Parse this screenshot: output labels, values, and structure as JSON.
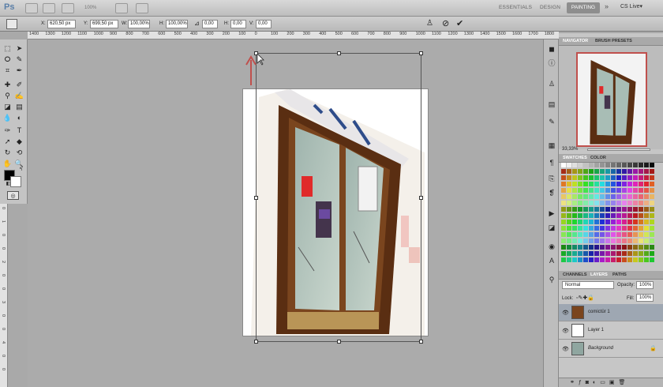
{
  "appbar": {
    "logo": "Ps",
    "zoom": "100%",
    "workspaces": [
      "ESSENTIALS",
      "DESIGN"
    ],
    "active_workspace": "PAINTING",
    "more": "»",
    "cs_live": "CS Live▾"
  },
  "options": {
    "x_label": "X:",
    "x_value": "620,50 px",
    "y_label": "Y:",
    "y_value": "699,50 px",
    "w_label": "W:",
    "w_value": "100,00%",
    "h_label": "H:",
    "h_value": "100,00%",
    "rot_value": "0,00",
    "hskew_label": "H:",
    "hskew_value": "0,00",
    "vskew_label": "V:",
    "vskew_value": "0,00",
    "cancel_icon": "cancel-icon",
    "commit_icon": "check-icon"
  },
  "ruler_h": [
    "1400",
    "1300",
    "1200",
    "1100",
    "1000",
    "900",
    "800",
    "700",
    "600",
    "500",
    "400",
    "300",
    "200",
    "100",
    "0",
    "100",
    "200",
    "300",
    "400",
    "500",
    "600",
    "700",
    "800",
    "900",
    "1000",
    "1100",
    "1200",
    "1300",
    "1400",
    "1500",
    "1600",
    "1700",
    "1800"
  ],
  "ruler_v": [
    "0",
    "1",
    "0",
    "0",
    "2",
    "0",
    "0",
    "3",
    "0",
    "0",
    "4",
    "0",
    "0"
  ],
  "panels": {
    "navigator_tabs": [
      "NAVIGATOR",
      "BRUSH PRESETS"
    ],
    "zoom_pct": "33,33%",
    "swatch_tabs": [
      "SWATCHES",
      "COLOR"
    ],
    "layer_tabs": [
      "CHANNELS",
      "LAYERS",
      "PATHS"
    ],
    "blend_mode": "Normal",
    "opacity_label": "Opacity:",
    "opacity_value": "100%",
    "lock_label": "Lock:",
    "fill_label": "Fill:",
    "fill_value": "100%",
    "layers": [
      {
        "name": "comictür 1"
      },
      {
        "name": "Layer 1"
      },
      {
        "name": "Background"
      }
    ]
  },
  "colors": {
    "accent": "#c0504d",
    "selection_red": "#c0504d"
  }
}
